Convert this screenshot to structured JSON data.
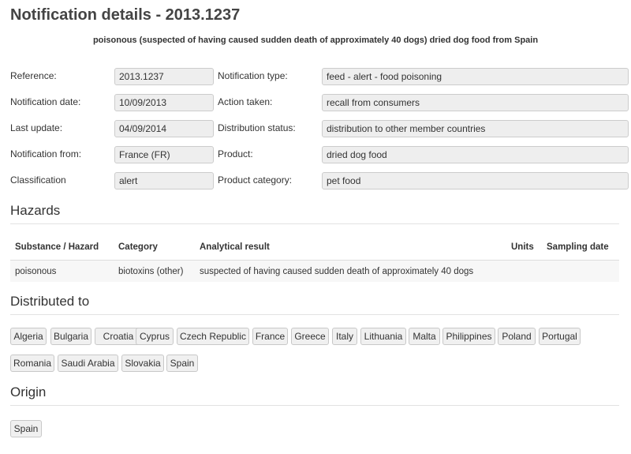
{
  "header": {
    "title": "Notification details - 2013.1237",
    "subtitle": "poisonous (suspected of having caused sudden death of approximately 40 dogs) dried dog food from Spain"
  },
  "details": {
    "rows": [
      {
        "left_label": "Reference:",
        "left_value": "2013.1237",
        "right_label": "Notification type:",
        "right_value": "feed - alert - food poisoning"
      },
      {
        "left_label": "Notification date:",
        "left_value": "10/09/2013",
        "right_label": "Action taken:",
        "right_value": "recall from consumers"
      },
      {
        "left_label": "Last update:",
        "left_value": "04/09/2014",
        "right_label": "Distribution status:",
        "right_value": "distribution to other member countries"
      },
      {
        "left_label": "Notification from:",
        "left_value": "France (FR)",
        "right_label": "Product:",
        "right_value": "dried dog food"
      },
      {
        "left_label": "Classification",
        "left_value": "alert",
        "right_label": "Product category:",
        "right_value": "pet food"
      }
    ]
  },
  "hazards": {
    "title": "Hazards",
    "columns": [
      "Substance / Hazard",
      "Category",
      "Analytical result",
      "Units",
      "Sampling date"
    ],
    "rows": [
      [
        "poisonous",
        "biotoxins (other)",
        "suspected of having caused sudden death of approximately 40 dogs",
        "",
        ""
      ]
    ]
  },
  "distributed": {
    "title": "Distributed to",
    "countries": [
      "Algeria",
      "Bulgaria",
      "Croatia",
      "Cyprus",
      "Czech Republic",
      "France",
      "Greece",
      "Italy",
      "Lithuania",
      "Malta",
      "Philippines",
      "Poland",
      "Portugal",
      "Romania",
      "Saudi Arabia",
      "Slovakia",
      "Spain"
    ]
  },
  "origin": {
    "title": "Origin",
    "countries": [
      "Spain"
    ]
  }
}
